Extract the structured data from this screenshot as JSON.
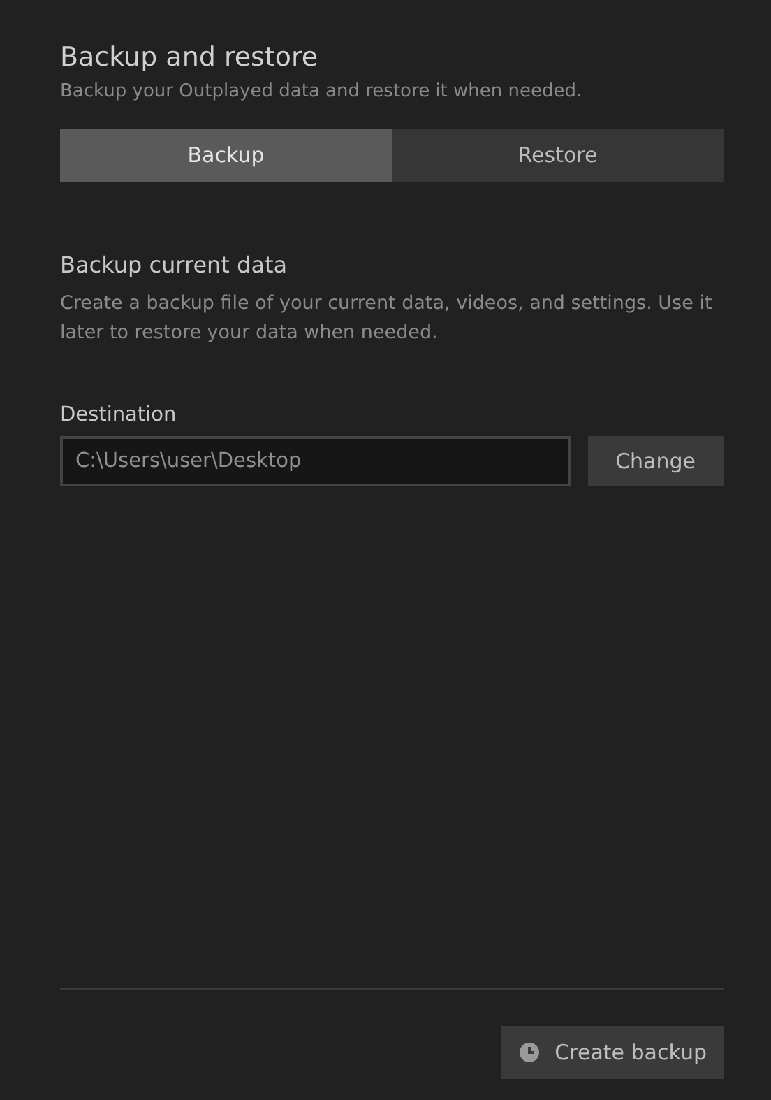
{
  "header": {
    "title": "Backup and restore",
    "subtitle": "Backup your Outplayed data and restore it when needed."
  },
  "tabs": [
    {
      "label": "Backup",
      "selected": true
    },
    {
      "label": "Restore",
      "selected": false
    }
  ],
  "section": {
    "title": "Backup current data",
    "description": "Create a backup file of your current data, videos, and settings. Use it later to restore your data when needed."
  },
  "destination": {
    "label": "Destination",
    "value": "C:\\Users\\user\\Desktop",
    "button": "Change"
  },
  "footer": {
    "button": "Create backup"
  }
}
